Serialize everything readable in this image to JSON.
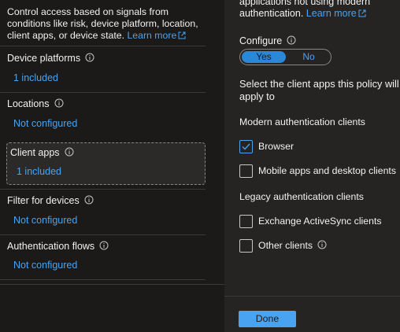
{
  "left": {
    "description": "Control access based on signals from conditions like risk, device platform, location, client apps, or device state.",
    "learn_more": "Learn more",
    "sections": [
      {
        "title": "Device platforms",
        "value": "1 included"
      },
      {
        "title": "Locations",
        "value": "Not configured"
      },
      {
        "title": "Client apps",
        "value": "1 included"
      },
      {
        "title": "Filter for devices",
        "value": "Not configured"
      },
      {
        "title": "Authentication flows",
        "value": "Not configured"
      }
    ]
  },
  "right": {
    "top_text": "applications not using modern authentication.",
    "learn_more": "Learn more",
    "configure_label": "Configure",
    "toggle": {
      "yes": "Yes",
      "no": "No",
      "selected": "Yes"
    },
    "select_text": "Select the client apps this policy will apply to",
    "modern_heading": "Modern authentication clients",
    "legacy_heading": "Legacy authentication clients",
    "options": [
      {
        "label": "Browser",
        "checked": true
      },
      {
        "label": "Mobile apps and desktop clients",
        "checked": false
      },
      {
        "label": "Exchange ActiveSync clients",
        "checked": false
      },
      {
        "label": "Other clients",
        "checked": false
      }
    ],
    "done_label": "Done"
  },
  "colors": {
    "accent": "#4aa3f0",
    "background": "#1b1a19",
    "panel": "#252423",
    "text": "#f3f2f1"
  }
}
